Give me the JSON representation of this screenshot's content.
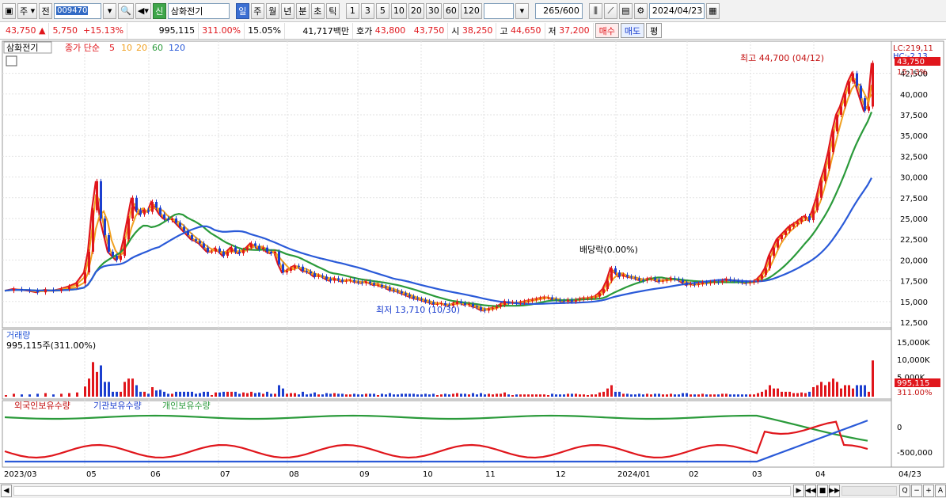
{
  "toolbar": {
    "type_select": "주",
    "prev_label": "전",
    "code": "009470",
    "badge": "신",
    "stock_name": "삼화전기",
    "periods": [
      "일",
      "주",
      "월",
      "년",
      "분",
      "초",
      "틱"
    ],
    "active_period": "일",
    "intervals": [
      "1",
      "3",
      "5",
      "10",
      "20",
      "30",
      "60",
      "120"
    ],
    "count_value": "265",
    "count_total": "/600",
    "date": "2024/04/23"
  },
  "quote": {
    "price": "43,750",
    "change": "5,750",
    "change_pct": "+15.13%",
    "volume": "995,115",
    "volume_ratio": "311.00%",
    "turnover": "15.05%",
    "amount": "41,717백만",
    "bid_label": "호가",
    "ask": "43,800",
    "bid": "43,750",
    "open_label": "시",
    "open": "38,250",
    "high_label": "고",
    "high": "44,650",
    "low_label": "저",
    "low": "37,200",
    "buy_button": "매수",
    "sell_button": "매도",
    "eval_button": "평"
  },
  "price_panel": {
    "stock_tag": "삼화전기",
    "legend_label": "종가 단순",
    "ma_periods": [
      "5",
      "10",
      "20",
      "60",
      "120"
    ],
    "ma_colors": [
      "#e0161c",
      "#f0a020",
      "#f0a020",
      "#2a9a3a",
      "#2a5ad8"
    ],
    "high_note": "최고 44,700 (04/12)",
    "low_note": "최저 13,710 (10/30)",
    "dividend_note": "배당락(0.00%)",
    "lc_label": "LC:219,11",
    "hc_label": "HC:-2.13",
    "last_price_tag": "43,750",
    "last_pct_tag": "15.13%",
    "y_ticks": [
      "42,500",
      "40,000",
      "37,500",
      "35,000",
      "32,500",
      "30,000",
      "27,500",
      "25,000",
      "22,500",
      "20,000",
      "17,500",
      "15,000",
      "12,500"
    ]
  },
  "volume_panel": {
    "title": "거래량",
    "current": "995,115주(311.00%)",
    "y_ticks": [
      "15,000K",
      "10,000K",
      "5,000K"
    ],
    "last_tag": "995,115",
    "last_pct": "311.00%"
  },
  "holding_panel": {
    "legend": [
      "외국인보유수량",
      "기관보유수량",
      "개인보유수량"
    ],
    "y_ticks": [
      "0",
      "-500,000"
    ]
  },
  "x_axis": {
    "labels": [
      "2023/03",
      "05",
      "06",
      "07",
      "08",
      "09",
      "10",
      "11",
      "12",
      "2024/01",
      "02",
      "03",
      "04",
      "04/23"
    ]
  },
  "chart_data": {
    "type": "candlestick",
    "title": "삼화전기",
    "y_range": [
      12500,
      45000
    ],
    "close_series": [
      [
        0,
        16300
      ],
      [
        10,
        16500
      ],
      [
        20,
        16400
      ],
      [
        30,
        16300
      ],
      [
        40,
        16100
      ],
      [
        50,
        16400
      ],
      [
        60,
        16300
      ],
      [
        70,
        16500
      ],
      [
        80,
        16800
      ],
      [
        90,
        17200
      ],
      [
        100,
        18500
      ],
      [
        105,
        21000
      ],
      [
        110,
        26000
      ],
      [
        115,
        29500
      ],
      [
        120,
        25000
      ],
      [
        125,
        23000
      ],
      [
        130,
        21000
      ],
      [
        135,
        20500
      ],
      [
        140,
        20000
      ],
      [
        145,
        20500
      ],
      [
        150,
        22500
      ],
      [
        155,
        25000
      ],
      [
        160,
        27500
      ],
      [
        165,
        26000
      ],
      [
        170,
        25500
      ],
      [
        175,
        26000
      ],
      [
        180,
        25800
      ],
      [
        185,
        27000
      ],
      [
        190,
        26300
      ],
      [
        195,
        25500
      ],
      [
        200,
        25000
      ],
      [
        205,
        24800
      ],
      [
        210,
        25000
      ],
      [
        215,
        24500
      ],
      [
        220,
        24000
      ],
      [
        225,
        23500
      ],
      [
        230,
        23000
      ],
      [
        235,
        22500
      ],
      [
        240,
        22300
      ],
      [
        245,
        22000
      ],
      [
        250,
        21500
      ],
      [
        255,
        21000
      ],
      [
        260,
        21000
      ],
      [
        265,
        21400
      ],
      [
        270,
        21000
      ],
      [
        275,
        20500
      ],
      [
        280,
        21000
      ],
      [
        285,
        21500
      ],
      [
        290,
        21000
      ],
      [
        295,
        20800
      ],
      [
        300,
        21200
      ],
      [
        305,
        21500
      ],
      [
        310,
        22000
      ],
      [
        315,
        21700
      ],
      [
        320,
        21300
      ],
      [
        325,
        21500
      ],
      [
        330,
        21000
      ],
      [
        335,
        20800
      ],
      [
        340,
        21000
      ],
      [
        345,
        19500
      ],
      [
        350,
        18500
      ],
      [
        355,
        18700
      ],
      [
        360,
        19000
      ],
      [
        365,
        19300
      ],
      [
        370,
        19200
      ],
      [
        375,
        18700
      ],
      [
        380,
        18600
      ],
      [
        385,
        18400
      ],
      [
        390,
        18000
      ],
      [
        395,
        18100
      ],
      [
        400,
        18000
      ],
      [
        405,
        17700
      ],
      [
        410,
        17500
      ],
      [
        415,
        17800
      ],
      [
        420,
        17600
      ],
      [
        425,
        17400
      ],
      [
        430,
        17500
      ],
      [
        435,
        17600
      ],
      [
        440,
        17400
      ],
      [
        445,
        17300
      ],
      [
        450,
        17200
      ],
      [
        455,
        17400
      ],
      [
        460,
        17200
      ],
      [
        465,
        17000
      ],
      [
        470,
        17000
      ],
      [
        475,
        16800
      ],
      [
        480,
        16700
      ],
      [
        485,
        16400
      ],
      [
        490,
        16300
      ],
      [
        495,
        16200
      ],
      [
        500,
        16000
      ],
      [
        505,
        15800
      ],
      [
        510,
        15600
      ],
      [
        515,
        15400
      ],
      [
        520,
        15300
      ],
      [
        525,
        15200
      ],
      [
        530,
        15000
      ],
      [
        535,
        14900
      ],
      [
        540,
        14700
      ],
      [
        545,
        14700
      ],
      [
        550,
        14800
      ],
      [
        555,
        14600
      ],
      [
        560,
        14500
      ],
      [
        565,
        14700
      ],
      [
        570,
        15000
      ],
      [
        575,
        14800
      ],
      [
        580,
        14600
      ],
      [
        585,
        14700
      ],
      [
        590,
        14400
      ],
      [
        595,
        14300
      ],
      [
        600,
        14000
      ],
      [
        605,
        13900
      ],
      [
        610,
        14100
      ],
      [
        615,
        14200
      ],
      [
        620,
        14400
      ],
      [
        625,
        14600
      ],
      [
        630,
        15000
      ],
      [
        635,
        14900
      ],
      [
        640,
        14900
      ],
      [
        645,
        14800
      ],
      [
        650,
        14900
      ],
      [
        655,
        15000
      ],
      [
        660,
        15100
      ],
      [
        665,
        15200
      ],
      [
        670,
        15300
      ],
      [
        675,
        15400
      ],
      [
        680,
        15500
      ],
      [
        685,
        15500
      ],
      [
        690,
        15300
      ],
      [
        695,
        15200
      ],
      [
        700,
        15100
      ],
      [
        705,
        15000
      ],
      [
        710,
        15200
      ],
      [
        715,
        15000
      ],
      [
        720,
        15200
      ],
      [
        725,
        15300
      ],
      [
        730,
        15400
      ],
      [
        735,
        15400
      ],
      [
        740,
        15500
      ],
      [
        745,
        15600
      ],
      [
        750,
        16000
      ],
      [
        755,
        16500
      ],
      [
        760,
        17500
      ],
      [
        765,
        19000
      ],
      [
        770,
        18500
      ],
      [
        775,
        18000
      ],
      [
        780,
        18200
      ],
      [
        785,
        18000
      ],
      [
        790,
        17900
      ],
      [
        795,
        17800
      ],
      [
        800,
        17600
      ],
      [
        805,
        17500
      ],
      [
        810,
        17700
      ],
      [
        815,
        17800
      ],
      [
        820,
        17600
      ],
      [
        825,
        17400
      ],
      [
        830,
        17500
      ],
      [
        835,
        17600
      ],
      [
        840,
        17800
      ],
      [
        845,
        17700
      ],
      [
        850,
        17600
      ],
      [
        855,
        17300
      ],
      [
        860,
        17000
      ],
      [
        865,
        17100
      ],
      [
        870,
        17000
      ],
      [
        875,
        17100
      ],
      [
        880,
        17300
      ],
      [
        885,
        17200
      ],
      [
        890,
        17300
      ],
      [
        895,
        17400
      ],
      [
        900,
        17300
      ],
      [
        905,
        17500
      ],
      [
        910,
        17700
      ],
      [
        915,
        17600
      ],
      [
        920,
        17500
      ],
      [
        925,
        17400
      ],
      [
        930,
        17300
      ],
      [
        935,
        17200
      ],
      [
        940,
        17300
      ],
      [
        945,
        17400
      ],
      [
        950,
        17700
      ],
      [
        955,
        18200
      ],
      [
        960,
        19000
      ],
      [
        965,
        20500
      ],
      [
        970,
        21500
      ],
      [
        975,
        22500
      ],
      [
        980,
        23000
      ],
      [
        985,
        23500
      ],
      [
        990,
        24000
      ],
      [
        995,
        24300
      ],
      [
        1000,
        24600
      ],
      [
        1005,
        25000
      ],
      [
        1010,
        25300
      ],
      [
        1015,
        24800
      ],
      [
        1020,
        26000
      ],
      [
        1025,
        27500
      ],
      [
        1030,
        29500
      ],
      [
        1035,
        31000
      ],
      [
        1040,
        33000
      ],
      [
        1045,
        35500
      ],
      [
        1050,
        37500
      ],
      [
        1055,
        38500
      ],
      [
        1060,
        40000
      ],
      [
        1065,
        41500
      ],
      [
        1070,
        42500
      ],
      [
        1075,
        41000
      ],
      [
        1080,
        39500
      ],
      [
        1085,
        38000
      ],
      [
        1090,
        38500
      ],
      [
        1095,
        43750
      ]
    ]
  }
}
